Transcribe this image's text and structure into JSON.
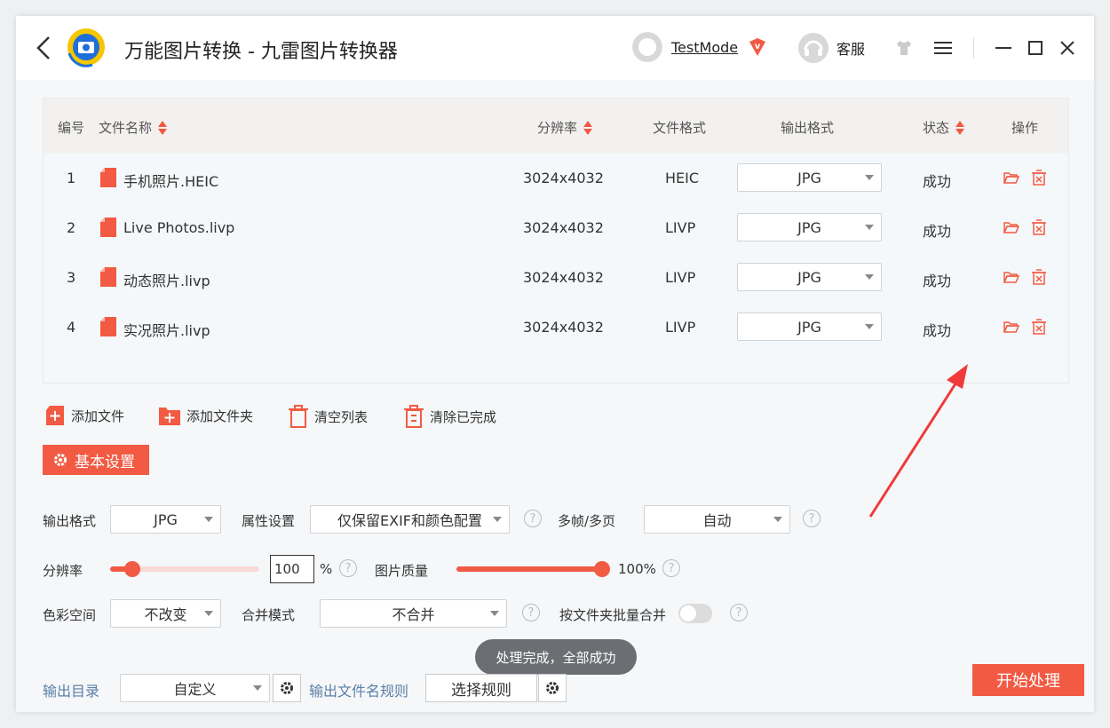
{
  "titlebar": {
    "title": "万能图片转换 - 九雷图片转换器",
    "username": "TestMode",
    "service_label": "客服"
  },
  "table": {
    "headers": {
      "index": "编号",
      "filename": "文件名称",
      "resolution": "分辨率",
      "format": "文件格式",
      "output_format": "输出格式",
      "status": "状态",
      "actions": "操作"
    },
    "rows": [
      {
        "index": "1",
        "filename": "手机照片.HEIC",
        "resolution": "3024x4032",
        "format": "HEIC",
        "output": "JPG",
        "status": "成功"
      },
      {
        "index": "2",
        "filename": "Live Photos.livp",
        "resolution": "3024x4032",
        "format": "LIVP",
        "output": "JPG",
        "status": "成功"
      },
      {
        "index": "3",
        "filename": "动态照片.livp",
        "resolution": "3024x4032",
        "format": "LIVP",
        "output": "JPG",
        "status": "成功"
      },
      {
        "index": "4",
        "filename": "实况照片.livp",
        "resolution": "3024x4032",
        "format": "LIVP",
        "output": "JPG",
        "status": "成功"
      }
    ]
  },
  "toolbar": {
    "add_file": "添加文件",
    "add_folder": "添加文件夹",
    "clear_list": "清空列表",
    "clear_done": "清除已完成"
  },
  "settings": {
    "basic_settings": "基本设置",
    "output_format_label": "输出格式",
    "output_format_value": "JPG",
    "attr_label": "属性设置",
    "attr_value": "仅保留EXIF和颜色配置",
    "frames_label": "多帧/多页",
    "frames_value": "自动",
    "resolution_label": "分辨率",
    "resolution_value": "100",
    "resolution_unit": "%",
    "resolution_fraction": 0.15,
    "quality_label": "图片质量",
    "quality_value": "100%",
    "quality_fraction": 1.0,
    "colorspace_label": "色彩空间",
    "colorspace_value": "不改变",
    "merge_label": "合并模式",
    "merge_value": "不合并",
    "batch_merge_label": "按文件夹批量合并",
    "help_glyph": "?"
  },
  "toast": "处理完成，全部成功",
  "footer": {
    "output_dir_label": "输出目录",
    "output_dir_value": "自定义",
    "filename_rule_label": "输出文件名规则",
    "select_rule": "选择规则",
    "start": "开始处理"
  },
  "colors": {
    "accent": "#f25a43",
    "link_blue": "#5a7fa8"
  }
}
